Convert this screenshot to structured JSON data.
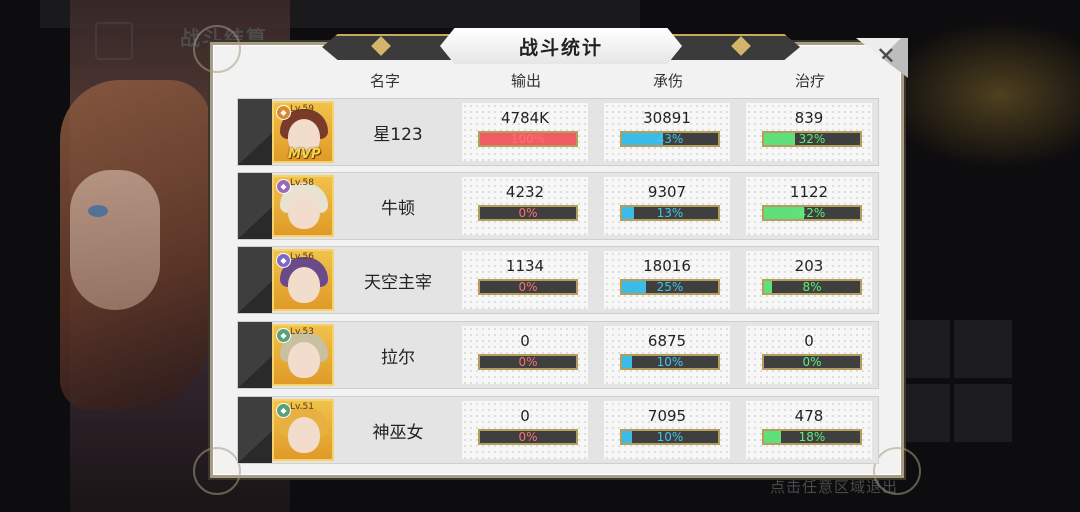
{
  "background": {
    "ghost_title": "战斗结算",
    "hint": "点击任意区域退出"
  },
  "dialog": {
    "title": "战斗统计",
    "close_icon": "close-x-icon"
  },
  "columns": {
    "name": "名字",
    "output": "输出",
    "damage_taken": "承伤",
    "healing": "治疗"
  },
  "colors": {
    "output": "#ef5d63",
    "damage_taken": "#3bbbe8",
    "healing": "#5fe07a",
    "bar_border": "#b59d5c"
  },
  "rows": [
    {
      "name": "星123",
      "level": "Lv.59",
      "mvp": "MVP",
      "output": {
        "value": "4784K",
        "percent": "100%",
        "fraction": 1.0
      },
      "damage_taken": {
        "value": "30891",
        "percent": "43%",
        "fraction": 0.43
      },
      "healing": {
        "value": "839",
        "percent": "32%",
        "fraction": 0.32
      }
    },
    {
      "name": "牛顿",
      "level": "Lv.58",
      "output": {
        "value": "4232",
        "percent": "0%",
        "fraction": 0.0
      },
      "damage_taken": {
        "value": "9307",
        "percent": "13%",
        "fraction": 0.13
      },
      "healing": {
        "value": "1122",
        "percent": "42%",
        "fraction": 0.42
      }
    },
    {
      "name": "天空主宰",
      "level": "Lv.56",
      "output": {
        "value": "1134",
        "percent": "0%",
        "fraction": 0.0
      },
      "damage_taken": {
        "value": "18016",
        "percent": "25%",
        "fraction": 0.25
      },
      "healing": {
        "value": "203",
        "percent": "8%",
        "fraction": 0.08
      }
    },
    {
      "name": "拉尔",
      "level": "Lv.53",
      "output": {
        "value": "0",
        "percent": "0%",
        "fraction": 0.0
      },
      "damage_taken": {
        "value": "6875",
        "percent": "10%",
        "fraction": 0.1
      },
      "healing": {
        "value": "0",
        "percent": "0%",
        "fraction": 0.0
      }
    },
    {
      "name": "神巫女",
      "level": "Lv.51",
      "output": {
        "value": "0",
        "percent": "0%",
        "fraction": 0.0
      },
      "damage_taken": {
        "value": "7095",
        "percent": "10%",
        "fraction": 0.1
      },
      "healing": {
        "value": "478",
        "percent": "18%",
        "fraction": 0.18
      }
    }
  ]
}
